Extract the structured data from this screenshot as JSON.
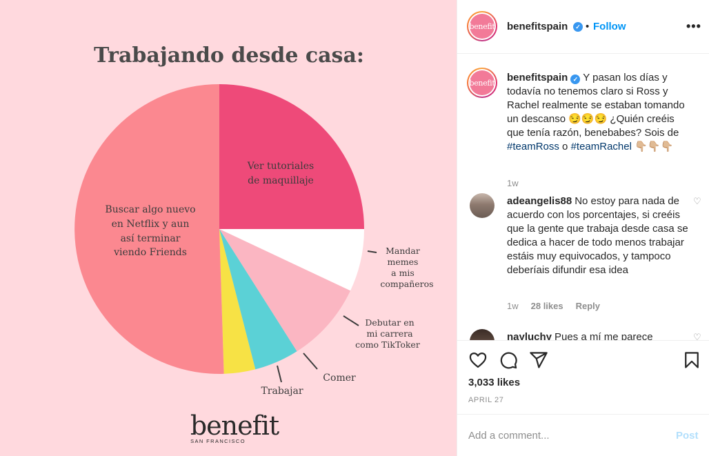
{
  "post_image": {
    "title": "Trabajando desde casa:",
    "brand_logo": "benefit",
    "brand_sub": "SAN FRANCISCO",
    "chart_data": {
      "type": "pie",
      "title": "Trabajando desde casa:",
      "slices": [
        {
          "label": "Ver tutoriales de maquillaje",
          "value": 25,
          "color": "#ee4a79"
        },
        {
          "label": "Mandar memes a mis compañeros",
          "value": 7,
          "color": "#ffffff"
        },
        {
          "label": "Debutar en mi carrera como TikToker",
          "value": 9,
          "color": "#fbb6c2"
        },
        {
          "label": "Comer",
          "value": 5,
          "color": "#5bd1d6"
        },
        {
          "label": "Trabajar",
          "value": 3.5,
          "color": "#f7e245"
        },
        {
          "label": "Buscar algo nuevo en Netflix y aun así terminar viendo Friends",
          "value": 50.5,
          "color": "#fb8890"
        }
      ]
    }
  },
  "header": {
    "username": "benefitspain",
    "avatar_text": "benefit",
    "dot": "•",
    "follow": "Follow",
    "more": "•••"
  },
  "caption": {
    "username": "benefitspain",
    "text_1": "Y pasan los días y todavía no tenemos claro si Ross y Rachel realmente se estaban tomando un descanso 😏😏😏 ¿Quién creéis que tenía razón, benebabes? Sois de ",
    "tag_1": "#teamRoss",
    "text_2": " o ",
    "tag_2": "#teamRachel",
    "text_3": " 👇🏼👇🏼👇🏼",
    "time": "1w"
  },
  "comments": [
    {
      "username": "adeangelis88",
      "text": "No estoy para nada de acuerdo con los porcentajes, si creéis que la gente que trabaja desde casa se dedica a hacer de todo menos trabajar estáis muy equivocados, y tampoco deberíais difundir esa idea",
      "time": "1w",
      "likes": "28 likes",
      "reply": "Reply"
    },
    {
      "username": "nayluchy",
      "text": "Pues a mí me parece"
    }
  ],
  "actions": {
    "likes": "3,033 likes",
    "date": "APRIL 27"
  },
  "add_comment": {
    "placeholder": "Add a comment...",
    "post": "Post"
  },
  "icons": {
    "heart": "heart-icon",
    "comment": "comment-icon",
    "share": "share-icon",
    "save": "bookmark-icon",
    "verified": "verified-badge-icon"
  },
  "colors": {
    "link": "#0095f6",
    "hashtag": "#00376b",
    "background": "#ffd9de"
  }
}
